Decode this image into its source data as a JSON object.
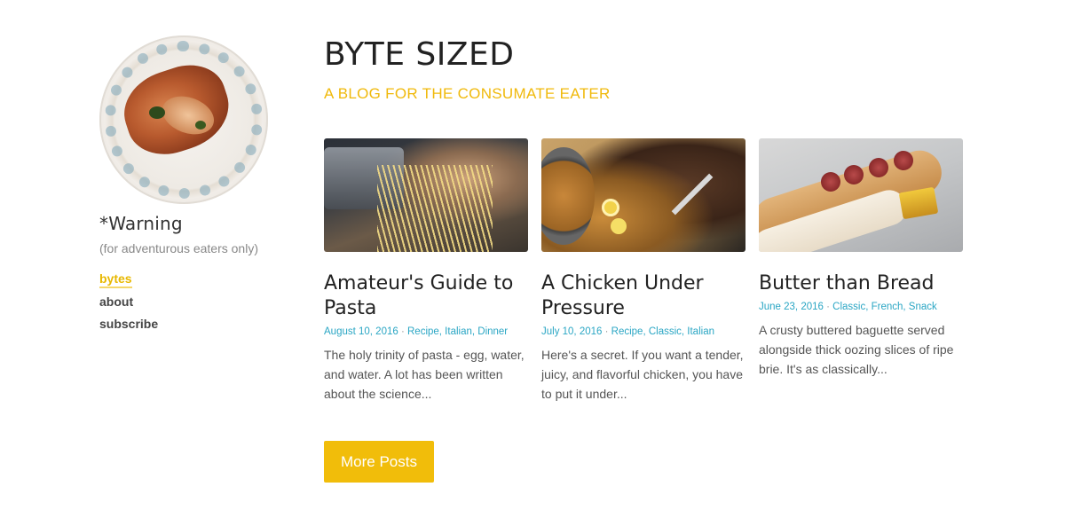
{
  "sidebar": {
    "name": "*Warning",
    "tagline": "(for adventurous eaters only)",
    "nav": [
      {
        "label": "bytes",
        "active": true
      },
      {
        "label": "about",
        "active": false
      },
      {
        "label": "subscribe",
        "active": false
      }
    ]
  },
  "header": {
    "title": "BYTE SIZED",
    "subtitle": "A BLOG FOR THE CONSUMATE EATER"
  },
  "posts": [
    {
      "title": "Amateur's Guide to Pasta",
      "date": "August 10, 2016",
      "categories": "Recipe, Italian, Dinner",
      "excerpt": "The holy trinity of pasta - egg, water, and water. A lot has been written about the science..."
    },
    {
      "title": "A Chicken Under Pressure",
      "date": "July 10, 2016",
      "categories": "Recipe, Classic, Italian",
      "excerpt": "Here's a secret. If you want a tender, juicy, and flavorful chicken, you have to put it under..."
    },
    {
      "title": "Butter than Bread",
      "date": "June 23, 2016",
      "categories": "Classic, French, Snack",
      "excerpt": "A crusty buttered baguette served alongside thick oozing slices of ripe brie. It's as classically..."
    }
  ],
  "more_button": "More Posts",
  "colors": {
    "accent": "#f1bd0a",
    "meta": "#2aa6c4"
  },
  "meta_separator": " · "
}
